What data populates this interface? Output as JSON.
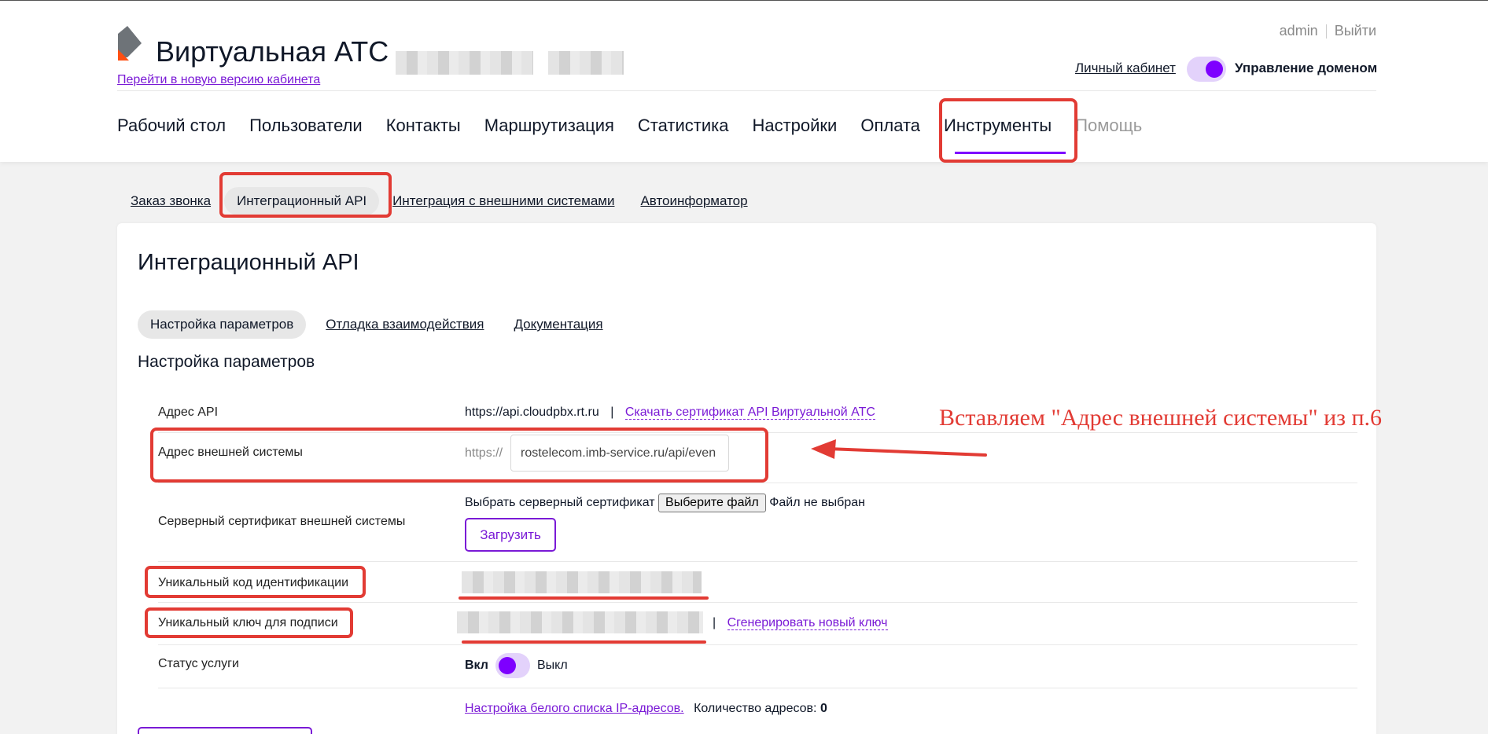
{
  "header": {
    "brand": "Виртуальная АТС",
    "new_version_link": "Перейти в новую версию кабинета",
    "user": "admin",
    "logout": "Выйти",
    "personal_cabinet": "Личный кабинет",
    "domain_management": "Управление доменом",
    "domain_toggle_on": true
  },
  "nav": {
    "items": [
      "Рабочий стол",
      "Пользователи",
      "Контакты",
      "Маршрутизация",
      "Статистика",
      "Настройки",
      "Оплата",
      "Инструменты",
      "Помощь"
    ],
    "active": "Инструменты"
  },
  "subnav": {
    "items": [
      "Заказ звонка",
      "Интеграционный API",
      "Интеграция с внешними системами",
      "Автоинформатор"
    ],
    "active": "Интеграционный API"
  },
  "card": {
    "title": "Интеграционный API",
    "tabs": [
      "Настройка параметров",
      "Отладка взаимодействия",
      "Документация"
    ],
    "active_tab": "Настройка параметров",
    "section_title": "Настройка параметров"
  },
  "rows": {
    "api_address": {
      "label": "Адрес API",
      "value": "https://api.cloudpbx.rt.ru",
      "separator": "|",
      "link": "Скачать сертификат API Виртуальной АТС"
    },
    "external_address": {
      "label": "Адрес внешней системы",
      "prefix": "https://",
      "value": "rostelecom.imb-service.ru/api/even"
    },
    "server_cert": {
      "label": "Серверный сертификат внешней системы",
      "choose_label": "Выбрать серверный сертификат",
      "choose_button": "Выберите файл",
      "no_file": "Файл не выбран",
      "upload": "Загрузить"
    },
    "unique_code": {
      "label": "Уникальный код идентификации"
    },
    "signature_key": {
      "label": "Уникальный ключ для подписи",
      "separator": "|",
      "link": "Сгенерировать новый ключ"
    },
    "service_status": {
      "label": "Статус услуги",
      "on": "Вкл",
      "off": "Выкл"
    },
    "whitelist": {
      "link": "Настройка белого списка IP-адресов.",
      "count_label": "Количество адресов:",
      "count": "0"
    }
  },
  "annotation": {
    "text": "Вставляем \"Адрес внешней системы\" из п.6"
  },
  "colors": {
    "accent": "#7e00ff",
    "link": "#7a1ad6",
    "annotation": "#e23b34",
    "logo_orange": "#ff4f12",
    "logo_gray": "#6e7378"
  }
}
